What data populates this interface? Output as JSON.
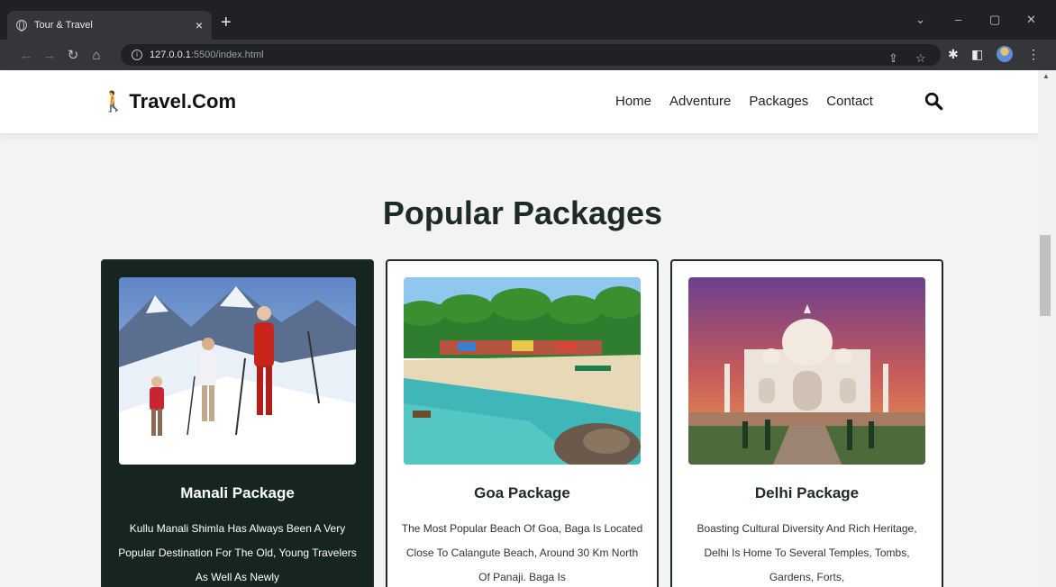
{
  "browser": {
    "tab_title": "Tour & Travel",
    "tab_close": "×",
    "new_tab": "+",
    "url_host": "127.0.0.1",
    "url_path": ":5500/index.html"
  },
  "header": {
    "logo_text": "Travel.Com",
    "nav": [
      "Home",
      "Adventure",
      "Packages",
      "Contact"
    ]
  },
  "section": {
    "title": "Popular Packages"
  },
  "packages": [
    {
      "title": "Manali Package",
      "description": "Kullu Manali Shimla Has Always Been A Very Popular Destination For The Old, Young Travelers As Well As Newly"
    },
    {
      "title": "Goa Package",
      "description": "The Most Popular Beach Of Goa, Baga Is Located Close To Calangute Beach, Around 30 Km North Of Panaji. Baga Is"
    },
    {
      "title": "Delhi Package",
      "description": "Boasting Cultural Diversity And Rich Heritage, Delhi Is Home To Several Temples, Tombs, Gardens, Forts,"
    }
  ],
  "colors": {
    "brand_dark": "#162520",
    "logo_green": "#1d9e3a",
    "page_bg": "#f3f3f3"
  }
}
